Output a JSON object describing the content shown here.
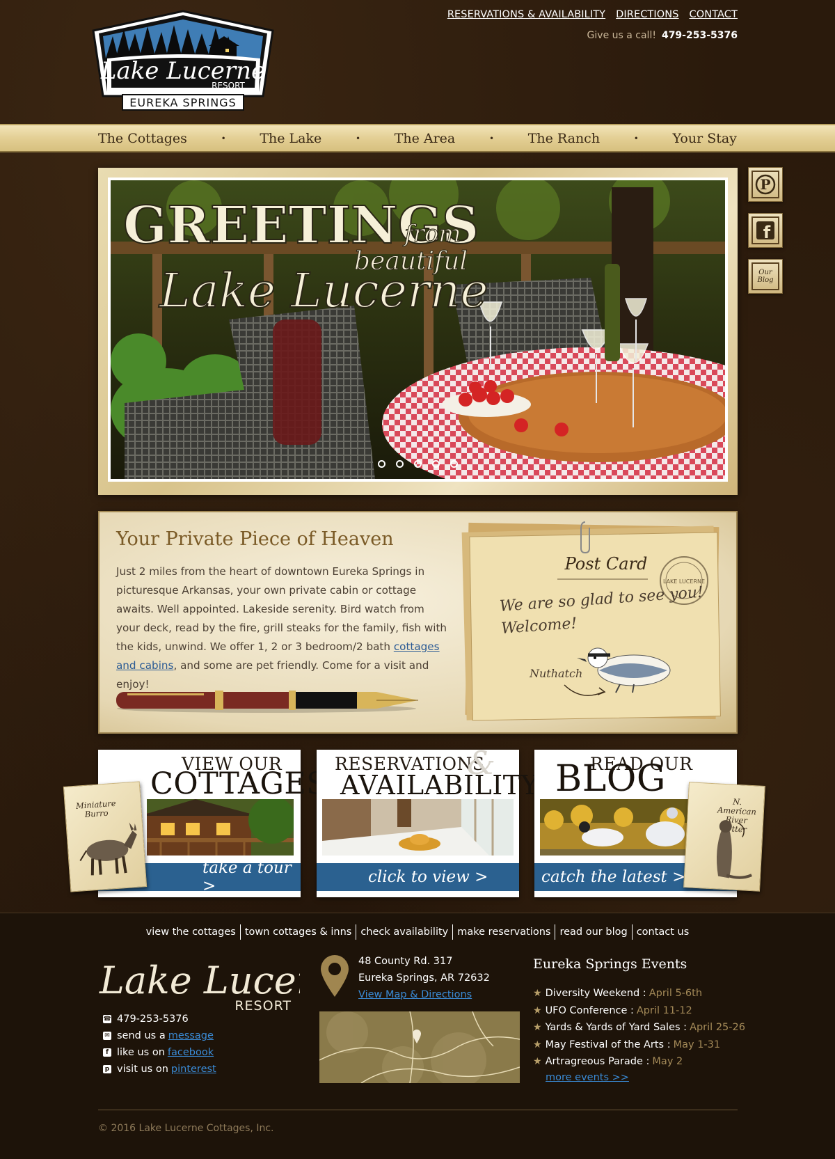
{
  "brand": {
    "name_script": "Lake Lucerne",
    "resort": "RESORT",
    "place": "EUREKA SPRINGS"
  },
  "top_links": [
    "RESERVATIONS & AVAILABILITY",
    "DIRECTIONS",
    "CONTACT"
  ],
  "phone_line": {
    "label": "Give us a call!",
    "number": "479-253-5376"
  },
  "nav": [
    "The Cottages",
    "The Lake",
    "The Area",
    "The Ranch",
    "Your Stay"
  ],
  "nav_separator": "•",
  "hero": {
    "line1": "GREETINGS",
    "line2": "from",
    "line3": "beautiful",
    "line4": "Lake Lucerne",
    "slide_count": 5
  },
  "social": [
    {
      "name": "pinterest",
      "glyph": "P"
    },
    {
      "name": "facebook",
      "glyph": "f"
    },
    {
      "name": "blog",
      "glyph": "Our Blog"
    }
  ],
  "intro": {
    "heading": "Your Private Piece of Heaven",
    "text_before": "Just 2 miles from the heart of downtown Eureka Springs in picturesque Arkansas, your own private cabin or cottage awaits. Well appointed. Lakeside serenity. Bird watch from your deck, read by the fire, grill steaks for the family, fish with the kids, unwind. We offer 1, 2 or 3 bedroom/2 bath ",
    "link": "cottages and cabins",
    "text_after": ", and some are pet friendly. Come for a visit and enjoy!",
    "postcard_title": "Post Card",
    "postcard_stamp": "LAKE LUCERNE",
    "postcard_message_1": "We are so glad to see you!",
    "postcard_message_2": "Welcome!",
    "postcard_bird": "Nuthatch"
  },
  "features": {
    "cottages": {
      "small": "VIEW OUR",
      "big": "COTTAGES",
      "cta": "take a tour  >",
      "note": "Miniature Burro"
    },
    "reservations": {
      "small": "RESERVATIONS",
      "amp": "&",
      "big": "AVAILABILITY",
      "cta": "click to view  >"
    },
    "blog": {
      "small": "READ OUR",
      "big": "BLOG",
      "cta": "catch the latest  >",
      "note": "N. American River Otter"
    }
  },
  "footer": {
    "links": [
      "view the cottages",
      "town cottages & inns",
      "check availability",
      "make reservations",
      "read our blog",
      "contact us"
    ],
    "contact": {
      "phone": "479-253-5376",
      "message_prefix": "send us a",
      "message_link": "message",
      "facebook_prefix": "like us on",
      "facebook_link": "facebook",
      "pinterest_prefix": "visit us on",
      "pinterest_link": "pinterest"
    },
    "address": {
      "line1": "48 County Rd. 317",
      "line2": "Eureka Springs, AR  72632",
      "map_link": "View Map & Directions"
    },
    "events_title": "Eureka Springs Events",
    "events": [
      {
        "name": "Diversity Weekend :",
        "date": "April 5-6th"
      },
      {
        "name": "UFO Conference :",
        "date": "April 11-12"
      },
      {
        "name": "Yards & Yards of Yard Sales :",
        "date": "April 25-26"
      },
      {
        "name": "May Festival of the Arts :",
        "date": "May 1-31"
      },
      {
        "name": "Artragreous Parade :",
        "date": "May 2"
      }
    ],
    "more_events": "more events >>",
    "copyright": "© 2016 Lake Lucerne Cottages, Inc."
  },
  "colors": {
    "background": "#2a1a0c",
    "nav_gold": "#e3cf94",
    "cta_blue": "#2b6190",
    "link_blue": "#3a8bd6",
    "heading_brown": "#7a5a26"
  }
}
